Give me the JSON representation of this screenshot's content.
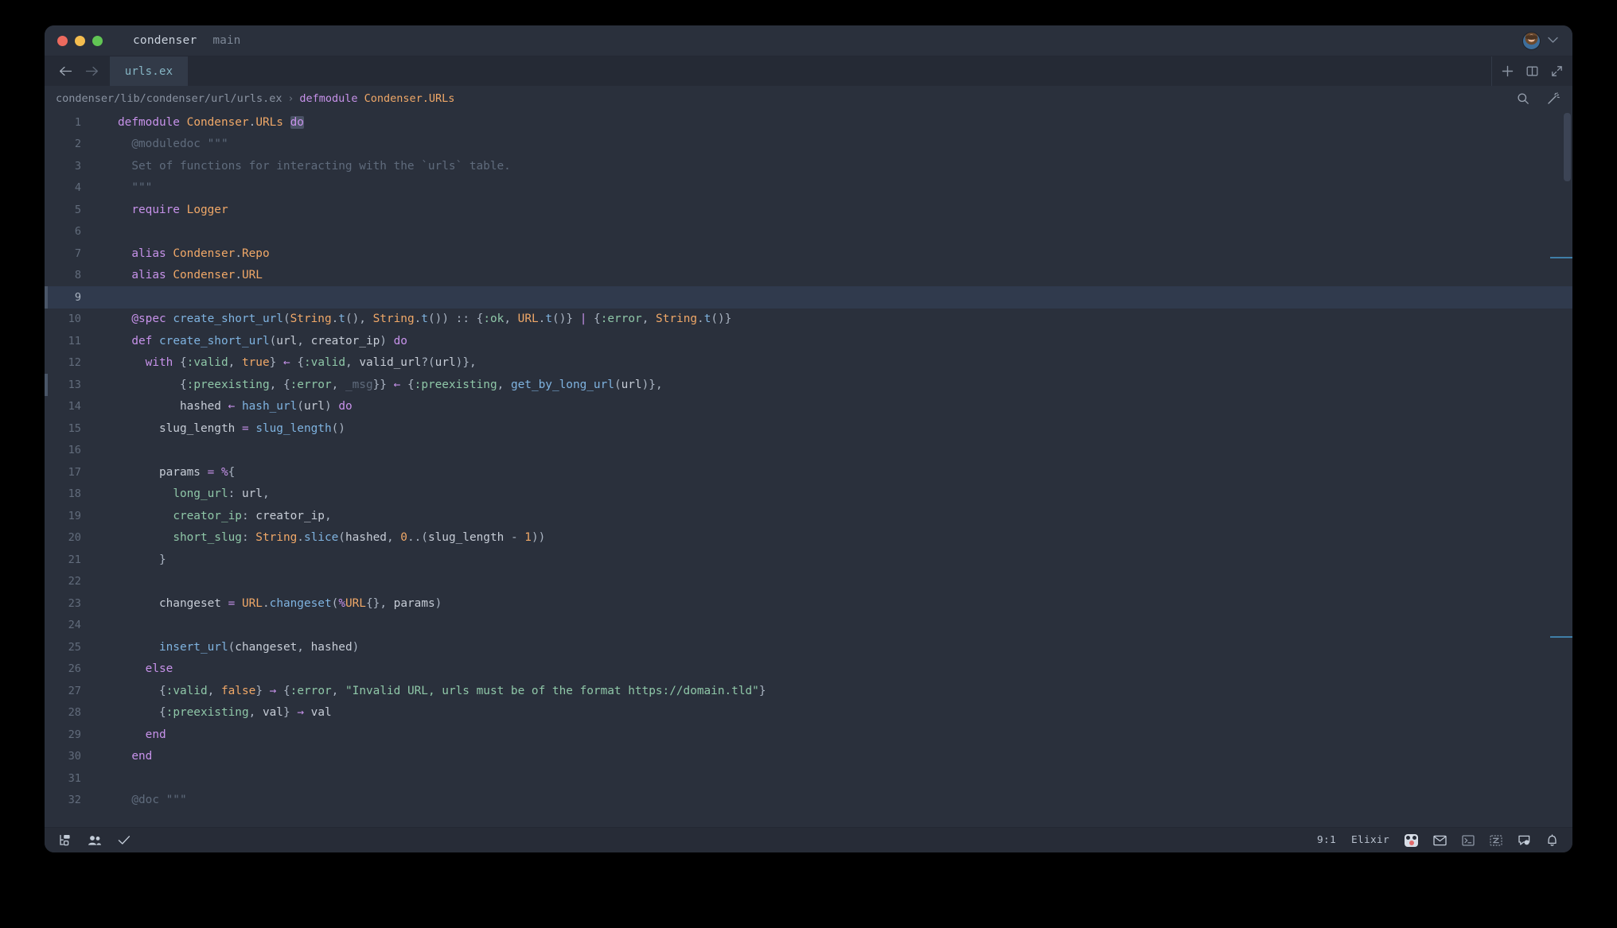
{
  "window": {
    "title": "condenser",
    "branch": "main",
    "traffic_lights": [
      "close",
      "minimize",
      "zoom"
    ],
    "account_chevron": "⌄"
  },
  "tabbar": {
    "back_label": "←",
    "forward_label": "→",
    "tabs": [
      {
        "label": "urls.ex",
        "active": true
      }
    ],
    "actions": [
      "new-file-icon",
      "split-editor-icon",
      "maximize-icon"
    ]
  },
  "breadcrumb": {
    "path": "condenser/lib/condenser/url/urls.ex",
    "separator": "›",
    "symbol_keyword": "defmodule",
    "symbol_name": "Condenser.URLs",
    "actions": [
      "search-icon",
      "magic-wand-icon"
    ]
  },
  "editor": {
    "language": "Elixir",
    "cursor": "9:1",
    "active_line": 9,
    "lines": [
      {
        "n": 1,
        "text": "defmodule Condenser.URLs do"
      },
      {
        "n": 2,
        "text": "  @moduledoc \"\"\""
      },
      {
        "n": 3,
        "text": "  Set of functions for interacting with the `urls` table."
      },
      {
        "n": 4,
        "text": "  \"\"\""
      },
      {
        "n": 5,
        "text": "  require Logger"
      },
      {
        "n": 6,
        "text": ""
      },
      {
        "n": 7,
        "text": "  alias Condenser.Repo"
      },
      {
        "n": 8,
        "text": "  alias Condenser.URL"
      },
      {
        "n": 9,
        "text": ""
      },
      {
        "n": 10,
        "text": "  @spec create_short_url(String.t(), String.t()) :: {:ok, URL.t()} | {:error, String.t()}"
      },
      {
        "n": 11,
        "text": "  def create_short_url(url, creator_ip) do"
      },
      {
        "n": 12,
        "text": "    with {:valid, true} <- {:valid, valid_url?(url)},"
      },
      {
        "n": 13,
        "text": "         {:preexisting, {:error, _msg}} <- {:preexisting, get_by_long_url(url)},"
      },
      {
        "n": 14,
        "text": "         hashed <- hash_url(url) do"
      },
      {
        "n": 15,
        "text": "      slug_length = slug_length()"
      },
      {
        "n": 16,
        "text": ""
      },
      {
        "n": 17,
        "text": "      params = %{"
      },
      {
        "n": 18,
        "text": "        long_url: url,"
      },
      {
        "n": 19,
        "text": "        creator_ip: creator_ip,"
      },
      {
        "n": 20,
        "text": "        short_slug: String.slice(hashed, 0..(slug_length - 1))"
      },
      {
        "n": 21,
        "text": "      }"
      },
      {
        "n": 22,
        "text": ""
      },
      {
        "n": 23,
        "text": "      changeset = URL.changeset(%URL{}, params)"
      },
      {
        "n": 24,
        "text": ""
      },
      {
        "n": 25,
        "text": "      insert_url(changeset, hashed)"
      },
      {
        "n": 26,
        "text": "    else"
      },
      {
        "n": 27,
        "text": "      {:valid, false} -> {:error, \"Invalid URL, urls must be of the format https://domain.tld\"}"
      },
      {
        "n": 28,
        "text": "      {:preexisting, val} -> val"
      },
      {
        "n": 29,
        "text": "    end"
      },
      {
        "n": 30,
        "text": "  end"
      },
      {
        "n": 31,
        "text": ""
      },
      {
        "n": 32,
        "text": "  @doc \"\"\""
      }
    ]
  },
  "statusbar": {
    "left_icons": [
      "source-control-icon",
      "live-share-icon",
      "checkmark-icon"
    ],
    "cursor_position": "9:1",
    "language": "Elixir",
    "right_icons": [
      "copilot-icon",
      "mail-icon",
      "terminal-icon",
      "zed-icon",
      "comment-icon",
      "bell-icon"
    ]
  },
  "colors": {
    "background": "#2a303c",
    "chrome": "#252a35",
    "active_line": "#303a4d",
    "keyword": "#c792ea",
    "module": "#f0a868",
    "function": "#7fb3e0",
    "atom": "#8fc7a8",
    "comment": "#5f6b7c",
    "text": "#c6ccd6",
    "tab_label": "#86b5c4"
  }
}
